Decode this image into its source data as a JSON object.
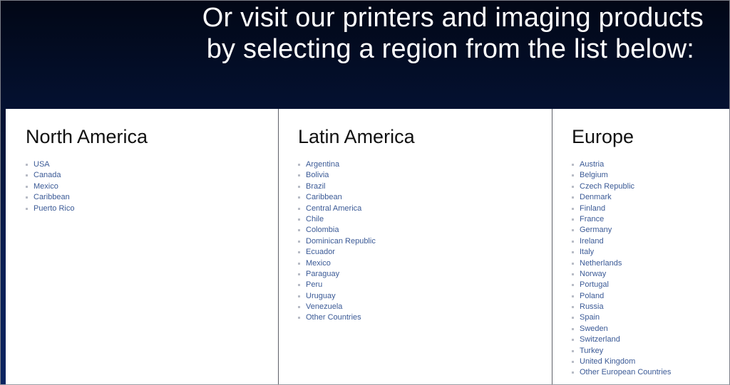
{
  "header": {
    "line1": "Or visit our printers and imaging products",
    "line2": "by selecting a region from the list below:"
  },
  "colors": {
    "header_bg_top": "#020716",
    "header_bg_bottom": "#0b2461",
    "link": "#3b5a96",
    "bullet": "#b8bcc6",
    "heading": "#111111"
  },
  "regions": [
    {
      "title": "North America",
      "items": [
        "USA",
        "Canada",
        "Mexico",
        "Caribbean",
        "Puerto Rico"
      ]
    },
    {
      "title": "Latin America",
      "items": [
        "Argentina",
        "Bolivia",
        "Brazil",
        "Caribbean",
        "Central America",
        "Chile",
        "Colombia",
        "Dominican Republic",
        "Ecuador",
        "Mexico",
        "Paraguay",
        "Peru",
        "Uruguay",
        "Venezuela",
        "Other Countries"
      ]
    },
    {
      "title": "Europe",
      "items": [
        "Austria",
        "Belgium",
        "Czech Republic",
        "Denmark",
        "Finland",
        "France",
        "Germany",
        "Ireland",
        "Italy",
        "Netherlands",
        "Norway",
        "Portugal",
        "Poland",
        "Russia",
        "Spain",
        "Sweden",
        "Switzerland",
        "Turkey",
        "United Kingdom",
        "Other European Countries"
      ]
    }
  ]
}
